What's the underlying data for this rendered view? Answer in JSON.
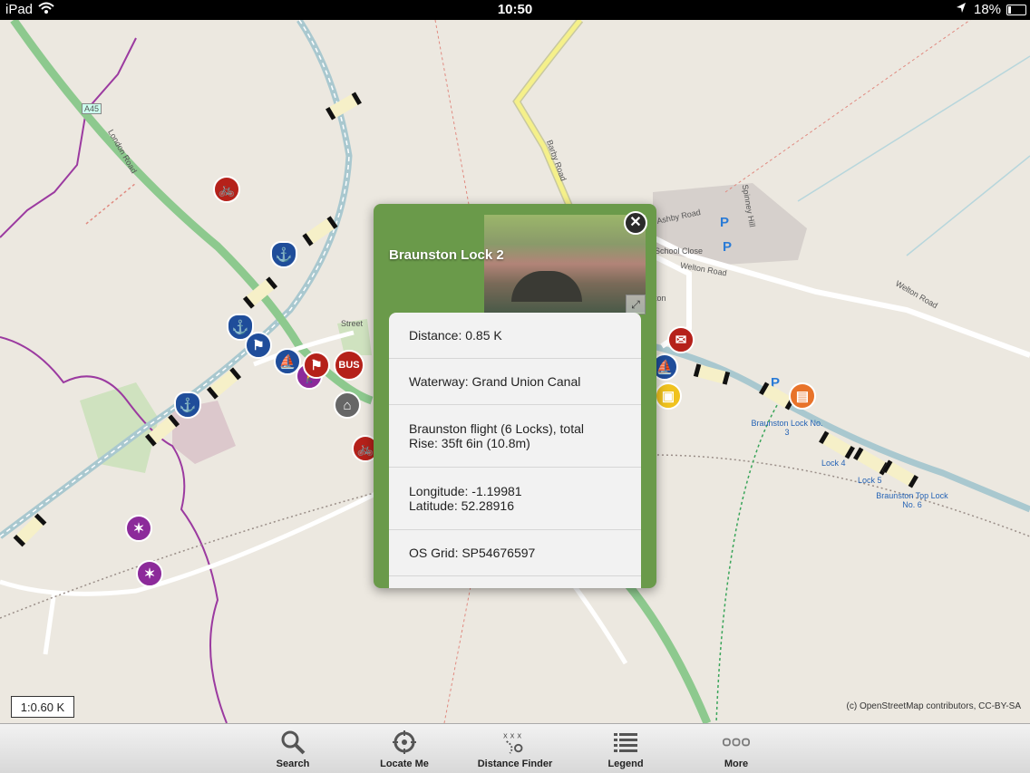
{
  "status_bar": {
    "carrier": "iPad",
    "time": "10:50",
    "battery": "18%"
  },
  "map": {
    "streets": [
      "A45",
      "London Road",
      "Barby Road",
      "Ashby Road",
      "School Close",
      "Welton Road",
      "Welton Road",
      "Spinney Hill",
      "Street",
      "ton"
    ],
    "locks": [
      "Braunston Lock No. 3",
      "Lock 4",
      "Lock 5",
      "Braunston Top Lock No. 6"
    ],
    "parking_label": "P",
    "bus_label": "BUS",
    "scale": "1:0.60 K",
    "attribution": "(c) OpenStreetMap contributors, CC-BY-SA"
  },
  "popup": {
    "title": "Braunston Lock 2",
    "rows": [
      {
        "line1": "Distance: 0.85 K",
        "line2": ""
      },
      {
        "line1": "Waterway: Grand Union Canal",
        "line2": ""
      },
      {
        "line1": "Braunston flight (6 Locks), total",
        "line2": "Rise: 35ft 6in (10.8m)"
      },
      {
        "line1": "Longitude: -1.19981",
        "line2": "Latitude: 52.28916"
      },
      {
        "line1": "OS Grid: SP54676597",
        "line2": ""
      }
    ]
  },
  "toolbar": {
    "items": [
      {
        "label": "Search",
        "icon": "search-icon"
      },
      {
        "label": "Locate Me",
        "icon": "locate-icon"
      },
      {
        "label": "Distance Finder",
        "icon": "distance-icon"
      },
      {
        "label": "Legend",
        "icon": "list-icon"
      },
      {
        "label": "More",
        "icon": "more-icon"
      }
    ]
  }
}
